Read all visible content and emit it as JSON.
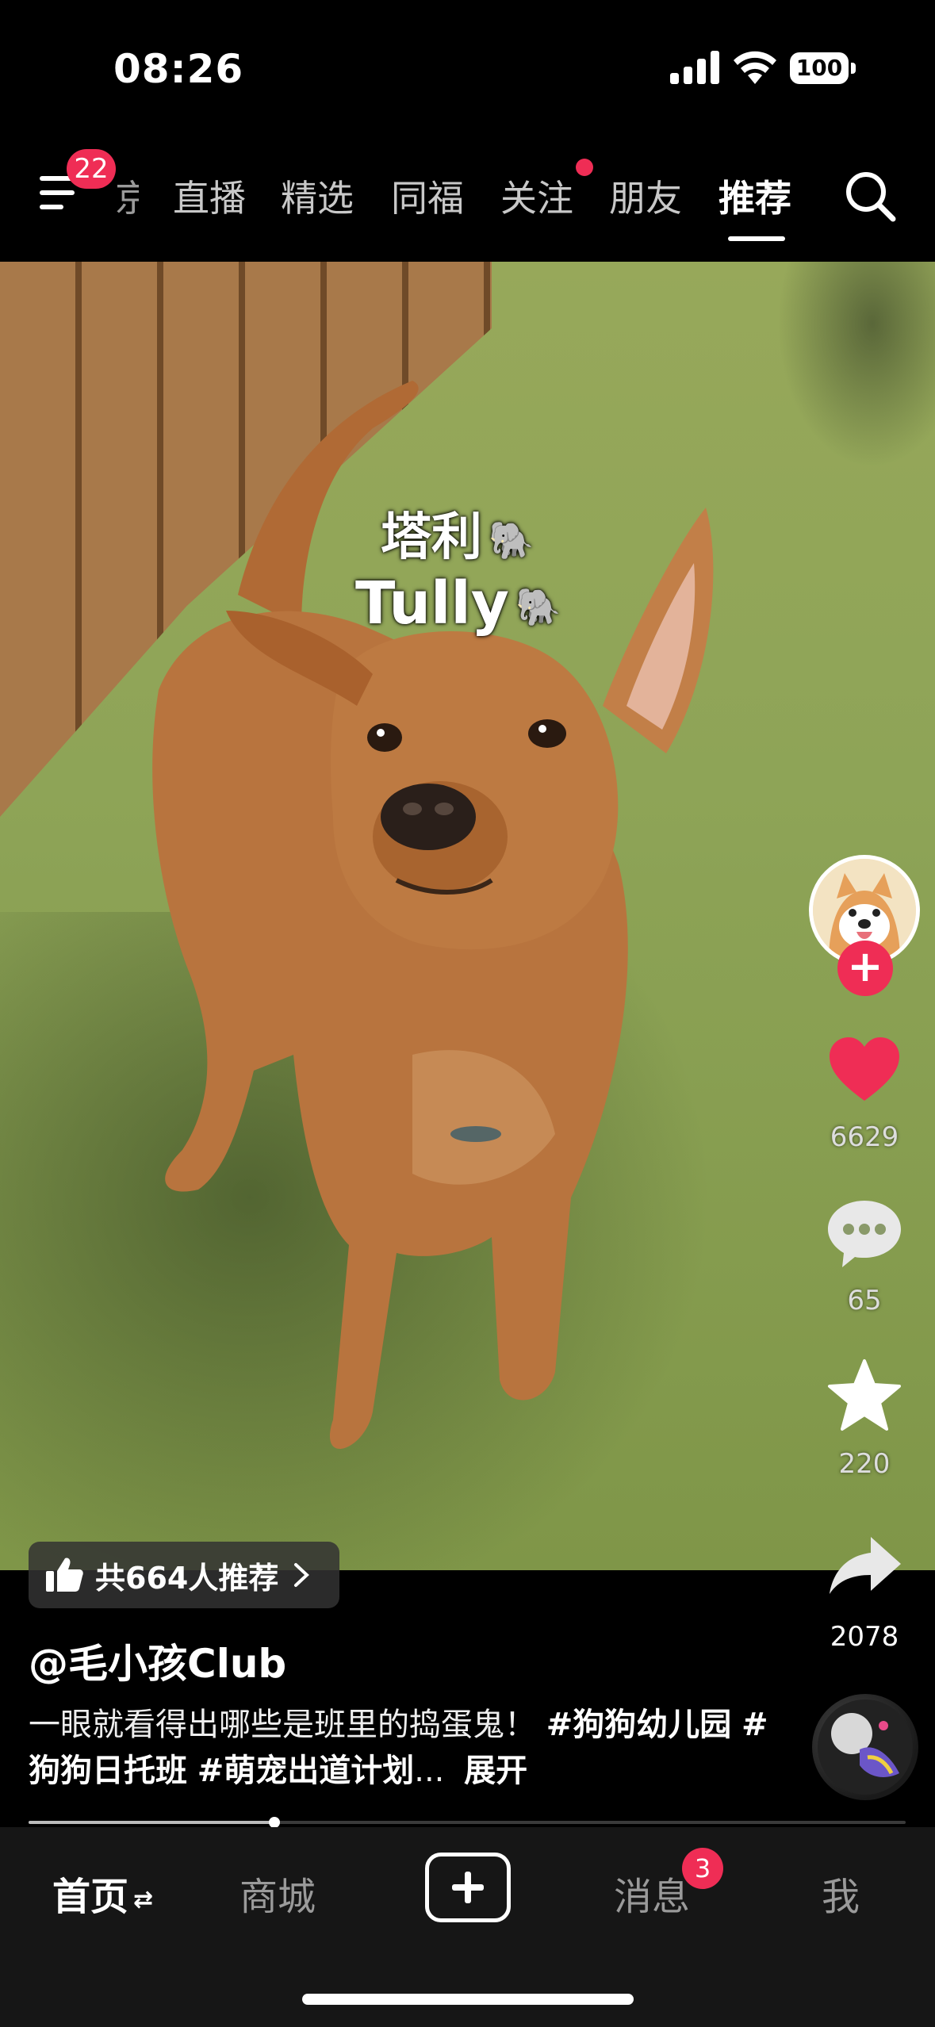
{
  "status_bar": {
    "time": "08:26",
    "battery": "100"
  },
  "top_nav": {
    "menu_badge": "22",
    "partial_tab": "京",
    "tabs": [
      "直播",
      "精选",
      "同福",
      "关注",
      "朋友",
      "推荐"
    ],
    "active_tab": "推荐",
    "follow_has_dot": true
  },
  "video": {
    "overlay_title_cn": "塔利",
    "overlay_title_en": "Tully",
    "overlay_emoji": "🐘"
  },
  "recommend_chip": {
    "text": "共664人推荐"
  },
  "right_rail": {
    "like_count": "6629",
    "comment_count": "65",
    "favorite_count": "220",
    "share_count": "2078"
  },
  "post": {
    "author": "@毛小孩Club",
    "caption": "一眼就看得出哪些是班里的捣蛋鬼！ ",
    "hashtags": [
      "#狗狗幼儿园",
      "#狗狗日托班",
      "#萌宠出道计划"
    ],
    "caption_ellipsis": "...",
    "expand_label": "展开"
  },
  "progress": {
    "fraction": 0.28
  },
  "bottom_tabs": {
    "home": "首页",
    "home_swap_icon": "⇄",
    "mall": "商城",
    "messages": "消息",
    "messages_badge": "3",
    "me": "我"
  },
  "colors": {
    "accent": "#ef2d55",
    "background": "#000000",
    "tabbar": "#161616"
  }
}
